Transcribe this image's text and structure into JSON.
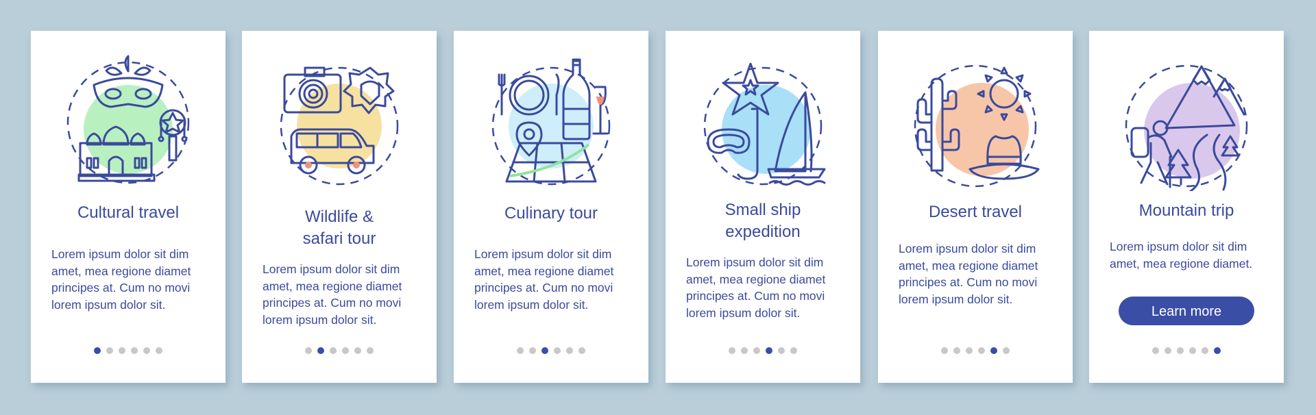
{
  "screens": [
    {
      "title_lines": [
        "Cultural travel"
      ],
      "body_lines": [
        "Lorem ipsum dolor sit dim",
        "amet, mea regione diamet",
        "principes at. Cum no movi",
        "lorem ipsum dolor sit."
      ],
      "icon": "cultural-travel-icon",
      "blob_color": "#b8f0c0",
      "active_page": 1
    },
    {
      "title_lines": [
        "Wildlife &",
        "safari tour"
      ],
      "body_lines": [
        "Lorem ipsum dolor sit dim",
        "amet, mea regione diamet",
        "principes at. Cum no movi",
        "lorem ipsum dolor sit."
      ],
      "icon": "wildlife-safari-icon",
      "blob_color": "#f6e1a0",
      "active_page": 2
    },
    {
      "title_lines": [
        "Culinary tour"
      ],
      "body_lines": [
        "Lorem ipsum dolor sit dim",
        "amet, mea regione diamet",
        "principes at. Cum no movi",
        "lorem ipsum dolor sit."
      ],
      "icon": "culinary-tour-icon",
      "blob_color": "#cdeefa",
      "active_page": 3
    },
    {
      "title_lines": [
        "Small ship",
        "expedition"
      ],
      "body_lines": [
        "Lorem ipsum dolor sit dim",
        "amet, mea regione diamet",
        "principes at. Cum no movi",
        "lorem ipsum dolor sit."
      ],
      "icon": "small-ship-expedition-icon",
      "blob_color": "#a9dff7",
      "active_page": 4
    },
    {
      "title_lines": [
        "Desert travel"
      ],
      "body_lines": [
        "Lorem ipsum dolor sit dim",
        "amet, mea regione diamet",
        "principes at. Cum no movi",
        "lorem ipsum dolor sit."
      ],
      "icon": "desert-travel-icon",
      "blob_color": "#f7c6a8",
      "active_page": 5
    },
    {
      "title_lines": [
        "Mountain trip"
      ],
      "body_lines": [
        "Lorem ipsum dolor sit dim",
        "amet, mea regione diamet."
      ],
      "icon": "mountain-trip-icon",
      "blob_color": "#d9c8ec",
      "active_page": 6,
      "button_label": "Learn more"
    }
  ],
  "page_count": 6,
  "colors": {
    "background": "#b9ced9",
    "card": "#ffffff",
    "text": "#3a4a9c",
    "accent": "#3b4ea6",
    "dot_inactive": "#c8c8c8",
    "icon_orange": "#f4907a",
    "icon_green": "#8fe3a0",
    "icon_cyan": "#8ee6f4"
  }
}
